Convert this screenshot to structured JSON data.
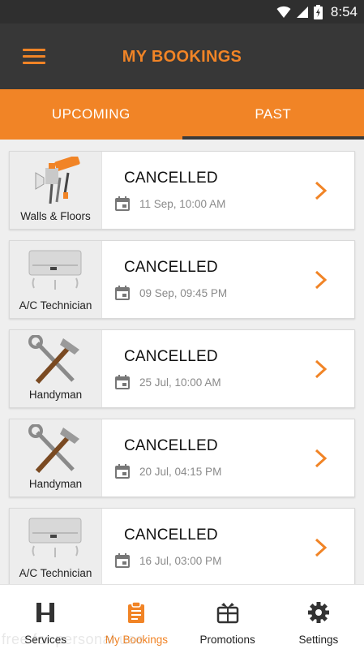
{
  "status_bar": {
    "time": "8:54",
    "icons": [
      "wifi-icon",
      "signal-icon",
      "battery-charging-icon"
    ]
  },
  "app_bar": {
    "title": "MY BOOKINGS",
    "menu_icon": "hamburger-menu-icon"
  },
  "tabs": [
    {
      "label": "UPCOMING",
      "active": false
    },
    {
      "label": "PAST",
      "active": true
    }
  ],
  "bookings": [
    {
      "service": "Walls & Floors",
      "icon": "paint-roller-icon",
      "status": "CANCELLED",
      "date": "11 Sep, 10:00 AM"
    },
    {
      "service": "A/C Technician",
      "icon": "air-conditioner-icon",
      "status": "CANCELLED",
      "date": "09 Sep, 09:45 PM"
    },
    {
      "service": "Handyman",
      "icon": "hammer-wrench-icon",
      "status": "CANCELLED",
      "date": "25 Jul, 10:00 AM"
    },
    {
      "service": "Handyman",
      "icon": "hammer-wrench-icon",
      "status": "CANCELLED",
      "date": "20 Jul, 04:15 PM"
    },
    {
      "service": "A/C Technician",
      "icon": "air-conditioner-icon",
      "status": "CANCELLED",
      "date": "16 Jul, 03:00 PM"
    }
  ],
  "bottom_nav": [
    {
      "label": "Services",
      "icon": "services-h-icon",
      "active": false
    },
    {
      "label": "My Bookings",
      "icon": "clipboard-icon",
      "active": true
    },
    {
      "label": "Promotions",
      "icon": "gift-icon",
      "active": false
    },
    {
      "label": "Settings",
      "icon": "gear-icon",
      "active": false
    }
  ],
  "colors": {
    "accent": "#f18426",
    "app_bar": "#373737",
    "status_bar": "#2f2f2f"
  },
  "watermark": "free for personal use"
}
